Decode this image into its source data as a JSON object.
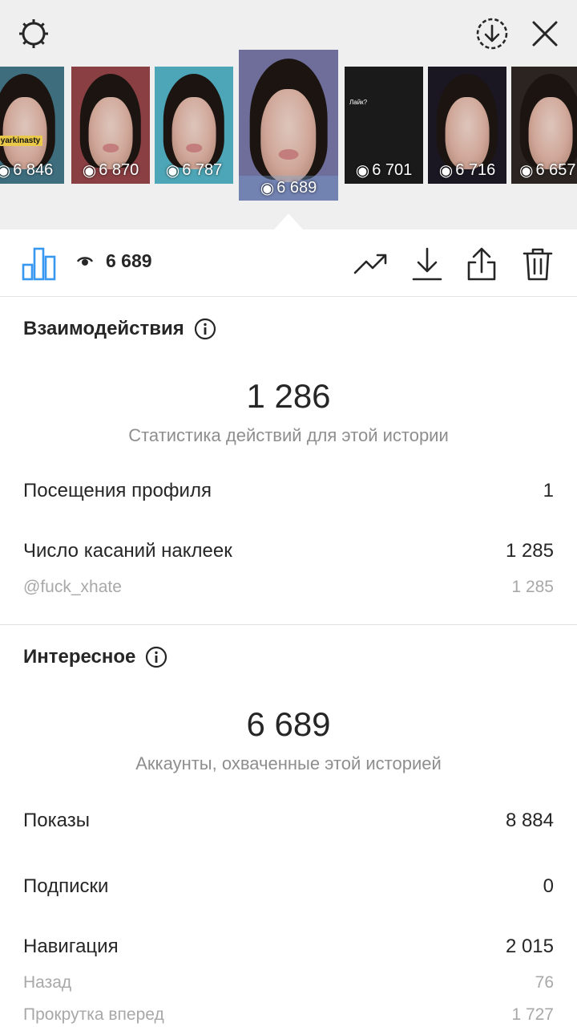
{
  "thumbnails": [
    {
      "views": "6 846",
      "tag": "@yarkinasty",
      "bg": "#3e6e7e"
    },
    {
      "views": "6 870",
      "bg": "#8a3f43"
    },
    {
      "views": "6 787",
      "bg": "#4da6b7"
    },
    {
      "views": "6 689",
      "bg": "#6f6e9a",
      "active": true
    },
    {
      "views": "6 701",
      "caption": "Лайк?",
      "bg": "#1b1a1a"
    },
    {
      "views": "6 716",
      "bg": "#1a1722"
    },
    {
      "views": "6 657",
      "bg": "#2b2420"
    }
  ],
  "action_bar": {
    "view_count": "6 689"
  },
  "interactions": {
    "title": "Взаимодействия",
    "total": "1 286",
    "subtitle": "Статистика действий для этой истории",
    "rows": [
      {
        "label": "Посещения профиля",
        "value": "1"
      },
      {
        "label": "Число касаний наклеек",
        "value": "1 285"
      }
    ],
    "sub_rows": [
      {
        "label": "@fuck_xhate",
        "value": "1 285"
      }
    ]
  },
  "discovery": {
    "title": "Интересное",
    "total": "6 689",
    "subtitle": "Аккаунты, охваченные этой историей",
    "rows": [
      {
        "label": "Показы",
        "value": "8 884"
      },
      {
        "label": "Подписки",
        "value": "0"
      },
      {
        "label": "Навигация",
        "value": "2 015"
      }
    ],
    "sub_rows": [
      {
        "label": "Назад",
        "value": "76"
      },
      {
        "label": "Прокрутка вперед",
        "value": "1 727"
      }
    ]
  },
  "colors": {
    "accent": "#3897f0",
    "text": "#262626",
    "muted": "#8e8e8e",
    "top_bg": "#efefef"
  },
  "icons": {
    "settings": "gear-icon",
    "download_all": "download-circle-icon",
    "close": "close-icon",
    "insights": "bar-chart-icon",
    "views": "eye-icon",
    "promote": "trending-up-icon",
    "save": "download-icon",
    "share": "share-icon",
    "delete": "trash-icon",
    "info": "info-icon"
  }
}
